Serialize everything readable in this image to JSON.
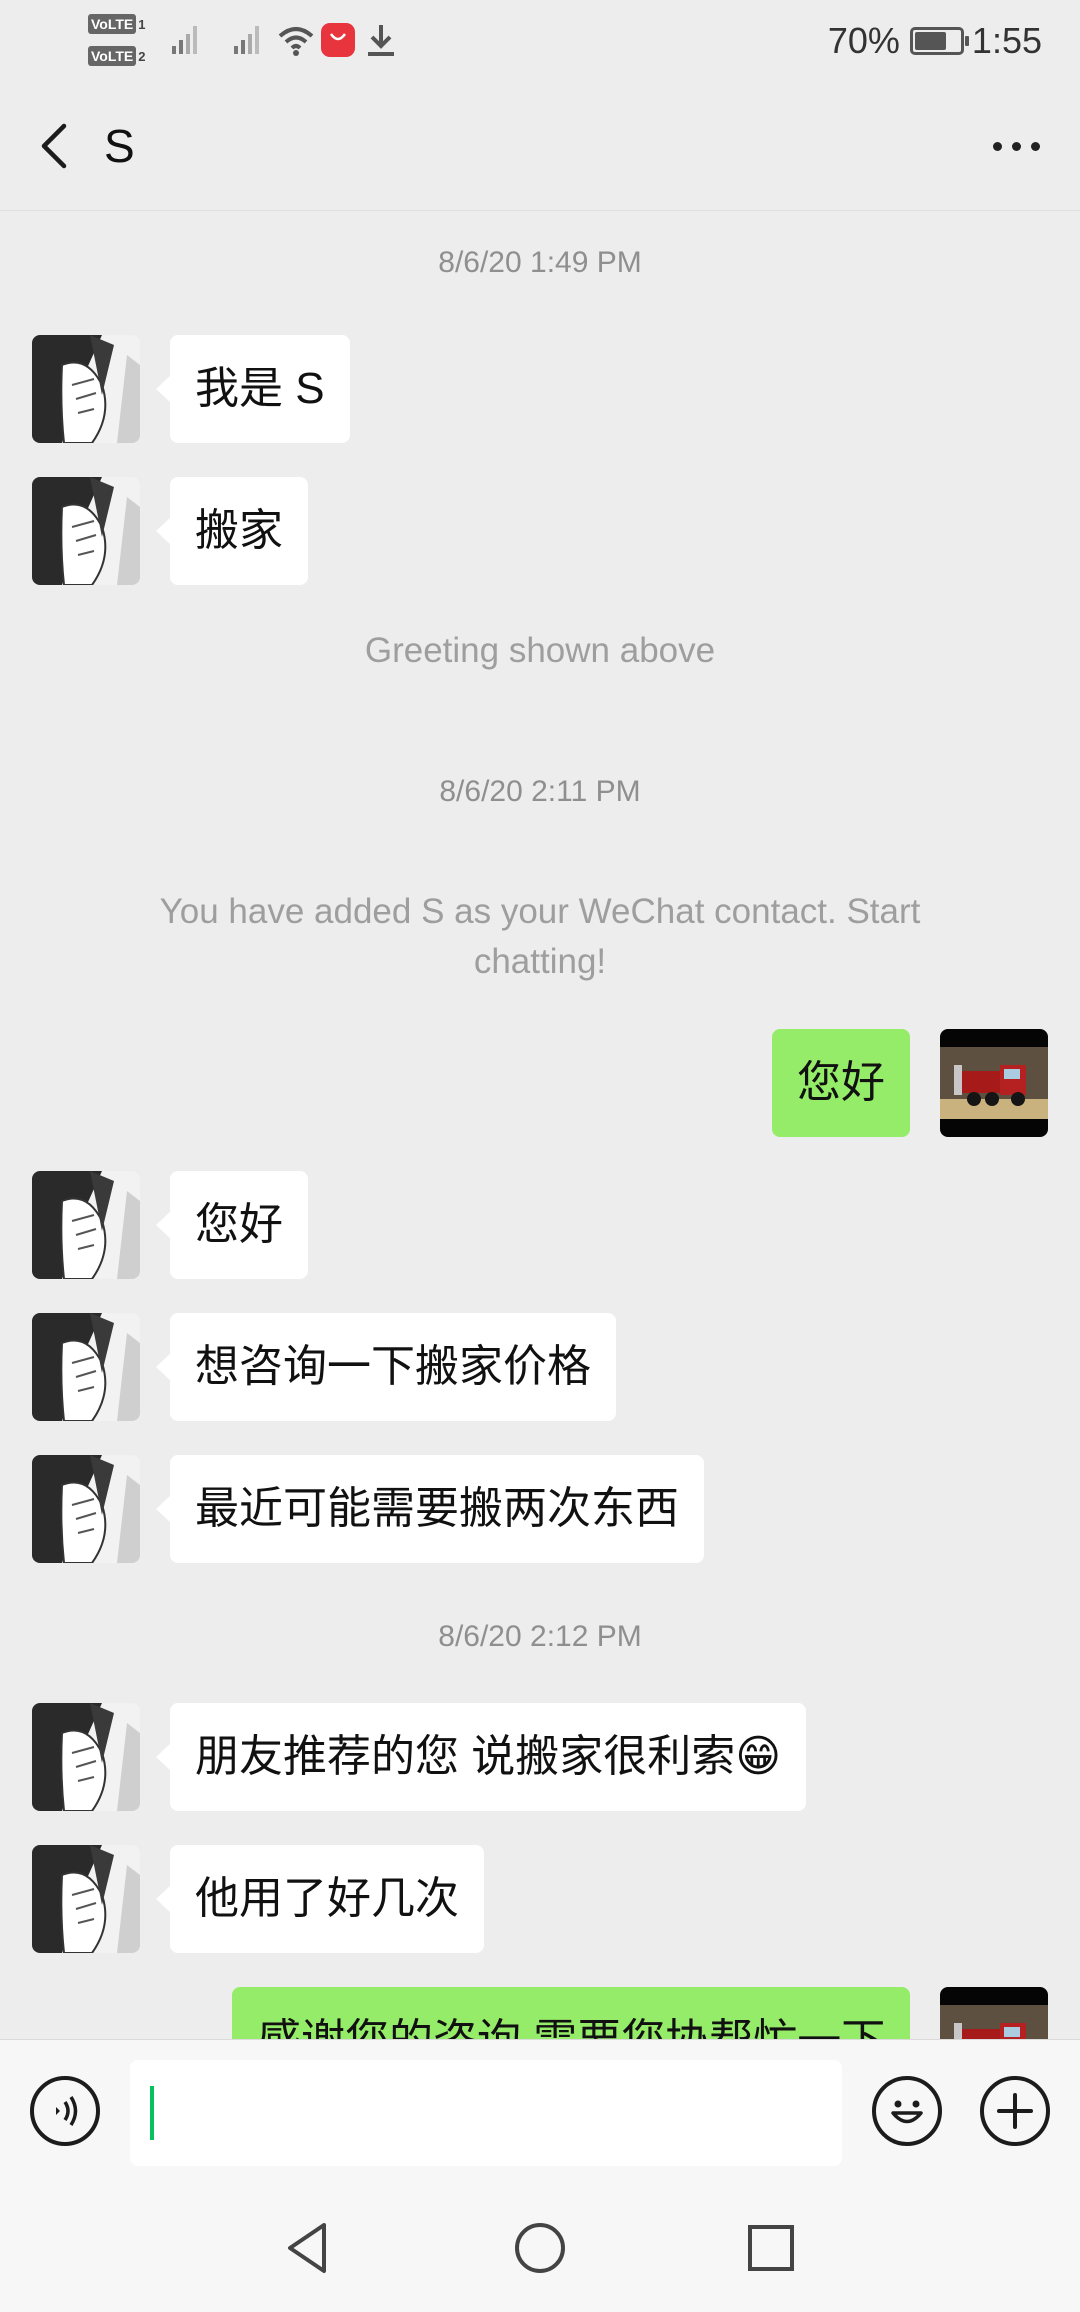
{
  "status_bar": {
    "sim1_label": "VoLTE",
    "sim1_slot": "1",
    "sim2_label": "VoLTE",
    "sim2_slot": "2",
    "battery_percent_text": "70%",
    "battery_level": 0.7,
    "time": "1:55",
    "icons": [
      "volte-icon",
      "signal-icon",
      "signal-icon",
      "wifi-icon",
      "huawei-appgallery-icon",
      "download-icon",
      "battery-icon"
    ]
  },
  "header": {
    "title": "S",
    "icons": [
      "back-arrow-icon",
      "more-icon"
    ]
  },
  "chat": {
    "items": [
      {
        "kind": "timestamp",
        "text": "8/6/20 1:49 PM"
      },
      {
        "kind": "message",
        "from": "them",
        "text": "我是 S"
      },
      {
        "kind": "message",
        "from": "them",
        "text": "搬家"
      },
      {
        "kind": "system",
        "text": "Greeting shown above"
      },
      {
        "kind": "timestamp",
        "text": "8/6/20 2:11 PM"
      },
      {
        "kind": "system",
        "text": "You have added S as your WeChat contact. Start chatting!"
      },
      {
        "kind": "message",
        "from": "me",
        "text": "您好"
      },
      {
        "kind": "message",
        "from": "them",
        "text": "您好"
      },
      {
        "kind": "message",
        "from": "them",
        "text": "想咨询一下搬家价格"
      },
      {
        "kind": "message",
        "from": "them",
        "text": "最近可能需要搬两次东西"
      },
      {
        "kind": "timestamp",
        "text": "8/6/20 2:12 PM"
      },
      {
        "kind": "message",
        "from": "them",
        "text": "朋友推荐的您 说搬家很利索😁"
      },
      {
        "kind": "message",
        "from": "them",
        "text": "他用了好几次"
      },
      {
        "kind": "message",
        "from": "me",
        "text": "感谢您的咨询 需要您协帮忙一下"
      }
    ]
  },
  "input_bar": {
    "value": "",
    "icons": [
      "voice-icon",
      "emoji-icon",
      "plus-icon"
    ]
  },
  "system_nav": {
    "icons": [
      "back-triangle-icon",
      "home-circle-icon",
      "recents-square-icon"
    ]
  },
  "colors": {
    "background": "#EDEDED",
    "my_bubble": "#95EC69",
    "their_bubble": "#FFFFFF",
    "accent": "#07C160"
  }
}
